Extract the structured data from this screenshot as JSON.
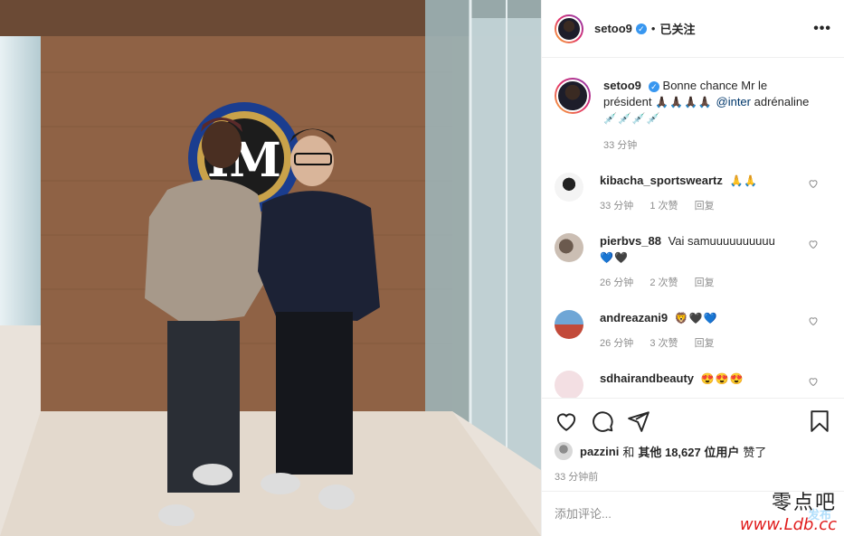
{
  "header": {
    "username": "setoo9",
    "dot": "•",
    "follow_label": "已关注",
    "more": "•••"
  },
  "caption": {
    "username": "setoo9",
    "text": "Bonne chance Mr le président",
    "emoji_pray": "🙏🏿🙏🏿🙏🏿🙏🏿",
    "mention": "@inter",
    "text2": "adrénaline",
    "emoji_syringe": "💉💉💉💉",
    "time": "33 分钟"
  },
  "comments": [
    {
      "username": "kibacha_sportsweartz",
      "text": "",
      "emoji": "🙏🙏",
      "time": "33 分钟",
      "likes": "1 次赞",
      "reply": "回复"
    },
    {
      "username": "pierbvs_88",
      "text": "Vai samuuuuuuuuuu",
      "emoji": "💙🖤",
      "time": "26 分钟",
      "likes": "2 次赞",
      "reply": "回复"
    },
    {
      "username": "andreazani9",
      "text": "",
      "emoji": "🦁🖤💙",
      "time": "26 分钟",
      "likes": "3 次赞",
      "reply": "回复"
    },
    {
      "username": "sdhairandbeauty",
      "text": "",
      "emoji": "😍😍😍",
      "time": "",
      "likes": "",
      "reply": ""
    }
  ],
  "likes": {
    "first_user": "pazzini",
    "connector": "和",
    "others": "其他 18,627 位用户",
    "suffix": "赞了"
  },
  "post_time": "33 分钟前",
  "comment_input": {
    "placeholder": "添加评论..."
  },
  "post_button": "发布",
  "watermark": {
    "line1": "零点吧",
    "line2": "www.Ldb.cc"
  },
  "colors": {
    "link": "#00376b",
    "verified": "#3897f0",
    "muted": "#8e8e8e",
    "watermark_red": "#e01d1d"
  }
}
